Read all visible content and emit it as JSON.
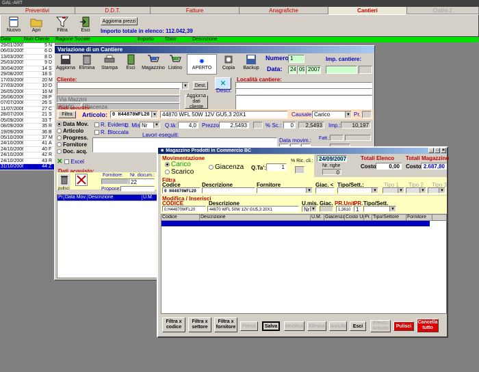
{
  "app": {
    "title": "GAL-ART"
  },
  "tabs": [
    {
      "label": "Preventivi",
      "active": false,
      "disabled": false
    },
    {
      "label": "D.D.T.",
      "active": false,
      "disabled": false
    },
    {
      "label": "Fatture",
      "active": false,
      "disabled": false
    },
    {
      "label": "Anagrafiche",
      "active": false,
      "disabled": false
    },
    {
      "label": "Cantieri",
      "active": true,
      "disabled": false
    },
    {
      "label": "Ordini 2",
      "active": false,
      "disabled": true
    }
  ],
  "toolbar": {
    "nuovo": "Nuovo",
    "apri": "Apri",
    "filtra": "Filtra",
    "esci": "Esci",
    "aggiorna_prezzi": "Aggiorna prezzi",
    "importo_label": "Importo totale in elenco: 112.042,39"
  },
  "list": {
    "headers": [
      "Data",
      "Numero",
      "Cliente",
      "Ragione Sociale",
      "Importo",
      "Stato",
      "Descrizione"
    ],
    "rows": [
      {
        "date": "29/01/2005",
        "num": "5",
        "c": "N"
      },
      {
        "date": "06/03/2005",
        "num": "6",
        "c": "D"
      },
      {
        "date": "13/03/2005",
        "num": "8",
        "c": "D"
      },
      {
        "date": "25/03/2005",
        "num": "9",
        "c": "D"
      },
      {
        "date": "30/04/2005",
        "num": "14",
        "c": "S"
      },
      {
        "date": "29/08/2005",
        "num": "18",
        "c": "S"
      },
      {
        "date": "17/03/2006",
        "num": "20",
        "c": "M"
      },
      {
        "date": "27/03/2006",
        "num": "10",
        "c": "D"
      },
      {
        "date": "26/05/2006",
        "num": "16",
        "c": "M"
      },
      {
        "date": "26/06/2006",
        "num": "28",
        "c": "P"
      },
      {
        "date": "07/07/2006",
        "num": "26",
        "c": "S"
      },
      {
        "date": "11/07/2006",
        "num": "27",
        "c": "C"
      },
      {
        "date": "28/07/2006",
        "num": "21",
        "c": "S"
      },
      {
        "date": "05/09/2006",
        "num": "33",
        "c": "T"
      },
      {
        "date": "08/09/2006",
        "num": "35",
        "c": "R"
      },
      {
        "date": "19/09/2006",
        "num": "36",
        "c": "B"
      },
      {
        "date": "05/10/2006",
        "num": "37",
        "c": "M"
      },
      {
        "date": "24/10/2006",
        "num": "41",
        "c": "A"
      },
      {
        "date": "24/10/2006",
        "num": "40",
        "c": "F"
      },
      {
        "date": "24/10/2006",
        "num": "42",
        "c": "R"
      },
      {
        "date": "24/10/2006",
        "num": "43",
        "c": "R"
      },
      {
        "date": "31/10/2006",
        "num": "44",
        "c": "Z"
      }
    ]
  },
  "cantiere": {
    "title": "Variazione di un Cantiere",
    "btns": {
      "aggiorna": "Aggiorna",
      "elimina": "Elimina",
      "stampa": "Stampa",
      "esci": "Esci",
      "magazzino": "Magazzino",
      "listino": "Listino",
      "aperto": "APERTO",
      "copia": "Copia",
      "backup": "Backup"
    },
    "numero_label": "Numero:",
    "numero": "1",
    "data_label": "Data:",
    "data_d": "24",
    "data_m": "09",
    "data_y": "2007",
    "imp_cantiere_label": "Imp. cantiere:",
    "cliente_label": "Cliente:",
    "dest_btn": "Dest.",
    "via": "Via Mazzini",
    "cap": "29100",
    "citta": "Piacenza",
    "aggiorna_cliente": "Aggiorna dati cliente",
    "localita_label": "Località cantiere:",
    "descr_label": "Descr.",
    "dati_vendita": "Dati vendita:",
    "filtra": "Filtra",
    "articolo_label": "Articolo:",
    "articolo_code": "0 H44870WFL20",
    "articolo_desc": "44870 WFL 50W 12V GU5,3 20X1",
    "causale_label": "Causale:",
    "causale": "Carico",
    "pr_label": "Pr.",
    "options": [
      "Data Mov.",
      "Articolo",
      "Progress.",
      "Fornitore",
      "Doc. acq."
    ],
    "r_evidenz": "R. Evidenz.",
    "r_bloccata": "R. Bloccata",
    "umis_label": "U. Mis.:",
    "umis": "Nr",
    "qta_label": "Q.tà:",
    "qta": "4,0",
    "prezzo_label": "Prezzo:",
    "prezzo": "2,5493",
    "sc_label": "% Sc.:",
    "sc": "0",
    "sc_val": "2,5493",
    "imp_label": "Imp.:",
    "imp": "10,197",
    "lavori_label": "Lavori eseguiti:",
    "data_movim_label": "Data movim.:",
    "fatt_label": "Fatt.:",
    "excel": "Excel",
    "dati_acquisto": "Dati acquisto:",
    "fornitore_label": "Fornitore:",
    "nr_docum_label": "Nr. docum.:",
    "nr_docum": "22",
    "pulisci": "pulisci",
    "propone_label": "Propone:",
    "grid_headers": [
      "Pr.",
      "Data Mov.",
      "Descrizione",
      "U.M."
    ]
  },
  "magazzino": {
    "title": "Magazzino Prodotti in Commercio BC",
    "movimentazione": "Movimentazione",
    "carico": "Carico",
    "scarico": "Scarico",
    "giacenza": "Giacenza",
    "qta_label": "Q.Ta':",
    "qta": "1",
    "ric_label": "% Ric. cli.:",
    "date": "24/09/2007",
    "nr_righe_label": "Nr. righe",
    "nr_righe": "0",
    "totali_elenco": "Totali  Elenco",
    "costo_label": "Costo:",
    "costo_elenco": "0,00",
    "totali_magazzino": "Totali  Magazzino",
    "costo_magazzino": "2.687,80",
    "filtra": "Filtra",
    "codice_label": "Codice",
    "descrizione_label": "Descrizione",
    "fornitore_label": "Fornitore",
    "giac_label": "Giac. <",
    "tipo_sett_label": "Tipo/Sett.:",
    "tipo1": "Tipo 1",
    "tipo2": "Tipo 2",
    "tipo3": "Tipo 3",
    "filter_codice": "0 H44870WFL20",
    "modifica": "Modifica / Inserisci",
    "codice_caps": "CODICE",
    "umis_label": "U.mis.",
    "giac2_label": "Giac.",
    "pr_unit_label": "PR.Unit.",
    "pr_label": "PR.",
    "tiposett_label": "Tipo/Sett.",
    "edit_codice": "0 H44870WFL20",
    "edit_desc": "44870 WFL 50W 12V GU5,3 20X1",
    "edit_umis": "Nr",
    "edit_prunit": "1,3610",
    "edit_pr": "1",
    "grid_headers": [
      "Codice",
      "Descrizione",
      "U.M.",
      "Giacenza",
      "Costo Un.",
      "Pr.",
      "Tipo/Settore",
      "Fornitore"
    ],
    "footer": {
      "filtra_codice": "Filtra x codice",
      "filtra_settore": "Filtra x settore",
      "filtra_fornitore": "Filtra x fornitore",
      "prendi": "Prendi",
      "salva": "Salva",
      "modifica": "Modifica",
      "elimina": "Elimina",
      "annulla": "Annulla",
      "esci": "Esci",
      "elenco_articolo": "Elenco Articolo",
      "pulisci": "Pulisci",
      "cancella_tutto": "Cancella tutto"
    }
  }
}
